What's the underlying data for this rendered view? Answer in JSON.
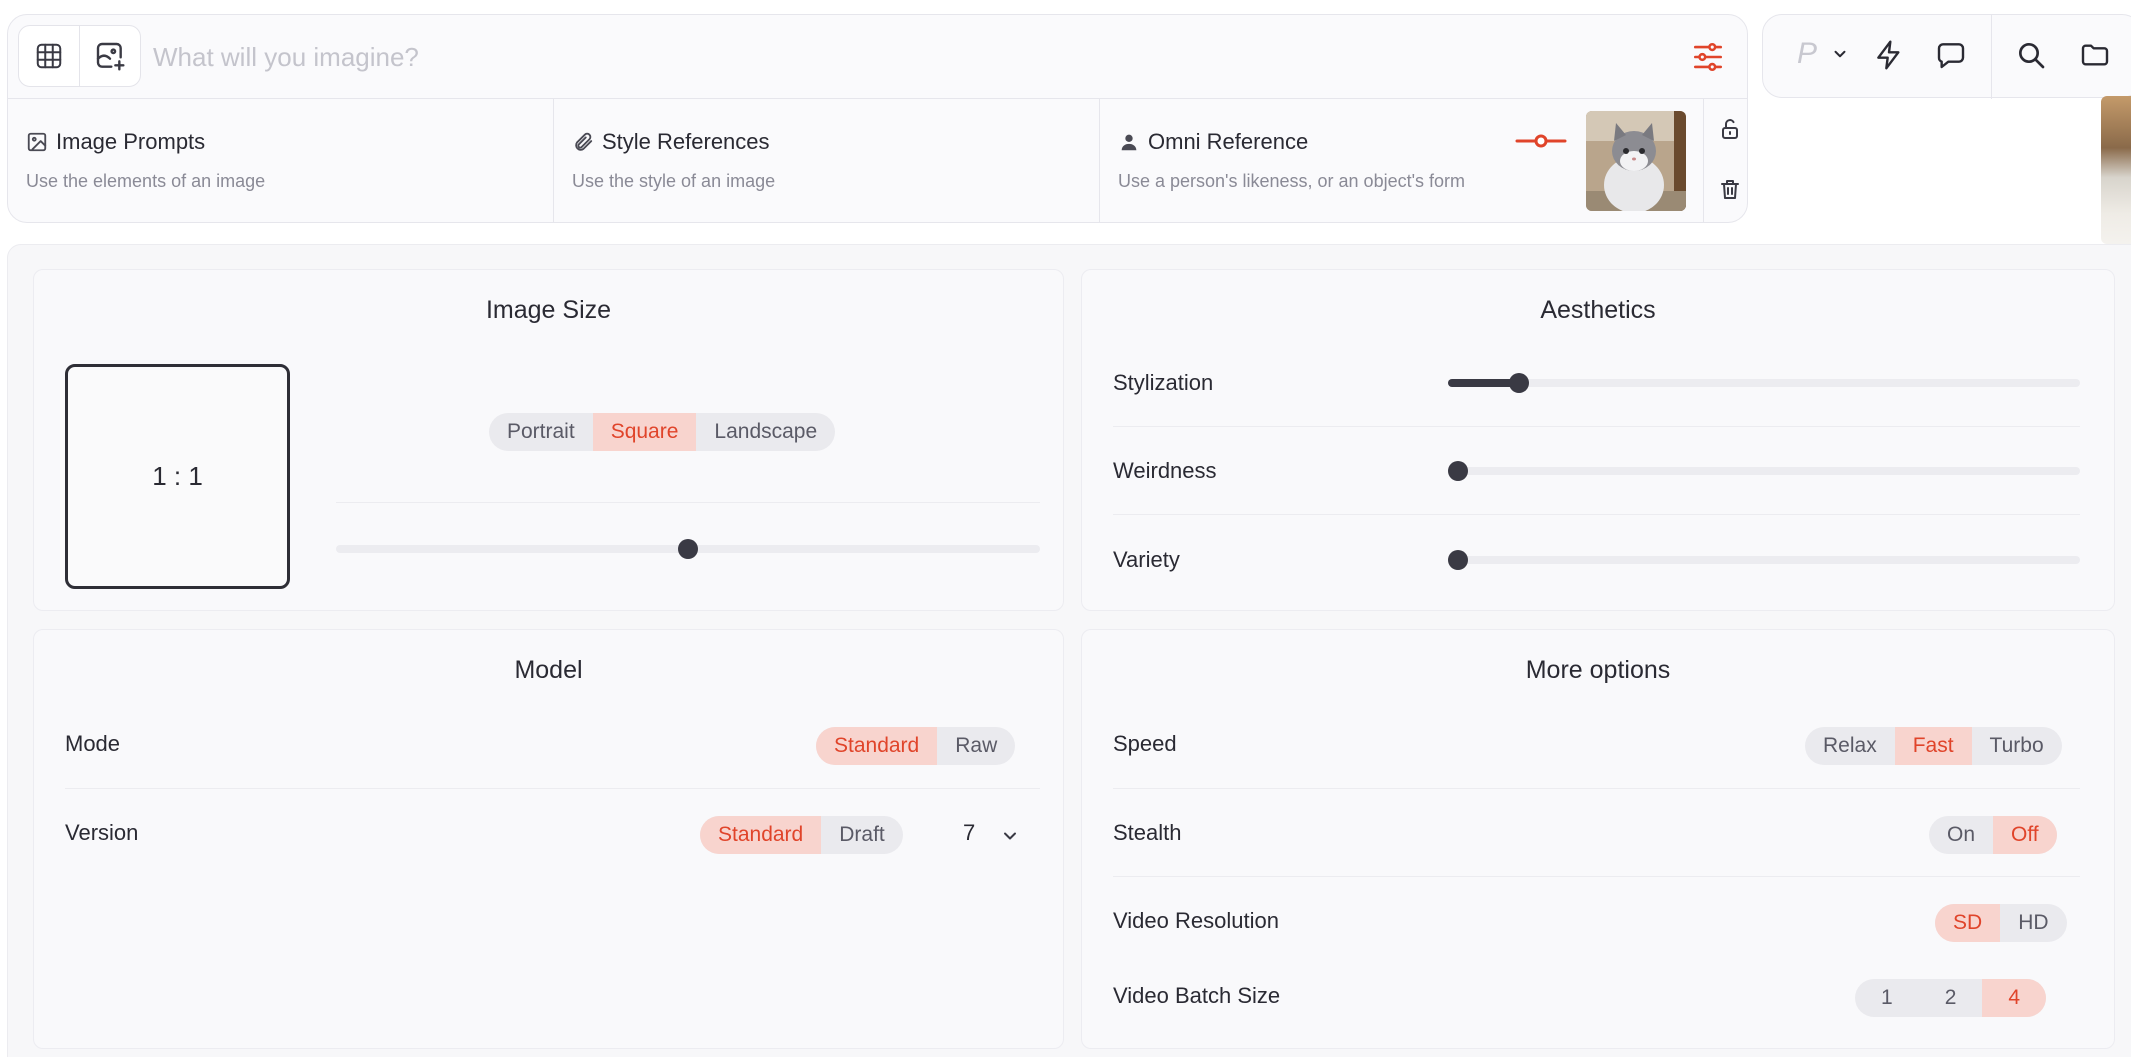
{
  "prompt": {
    "placeholder": "What will you imagine?",
    "value": ""
  },
  "references": [
    {
      "title": "Image Prompts",
      "subtitle": "Use the elements of an image"
    },
    {
      "title": "Style References",
      "subtitle": "Use the style of an image"
    },
    {
      "title": "Omni Reference",
      "subtitle": "Use a person's likeness, or an object's form"
    }
  ],
  "topbar": {
    "personalize_letter": "P"
  },
  "image_size": {
    "title": "Image Size",
    "ratio": "1 : 1",
    "options": [
      "Portrait",
      "Square",
      "Landscape"
    ],
    "selected": "Square",
    "slider_value": 0.5
  },
  "aesthetics": {
    "title": "Aesthetics",
    "sliders": [
      {
        "label": "Stylization",
        "value": 0.1
      },
      {
        "label": "Weirdness",
        "value": 0
      },
      {
        "label": "Variety",
        "value": 0
      }
    ]
  },
  "model": {
    "title": "Model",
    "mode": {
      "label": "Mode",
      "options": [
        "Standard",
        "Raw"
      ],
      "selected": "Standard"
    },
    "version": {
      "label": "Version",
      "options": [
        "Standard",
        "Draft"
      ],
      "selected": "Standard",
      "number": "7"
    }
  },
  "more_options": {
    "title": "More options",
    "speed": {
      "label": "Speed",
      "options": [
        "Relax",
        "Fast",
        "Turbo"
      ],
      "selected": "Fast"
    },
    "stealth": {
      "label": "Stealth",
      "options": [
        "On",
        "Off"
      ],
      "selected": "Off"
    },
    "video_resolution": {
      "label": "Video Resolution",
      "options": [
        "SD",
        "HD"
      ],
      "selected": "SD"
    },
    "video_batch_size": {
      "label": "Video Batch Size",
      "options": [
        "1",
        "2",
        "4"
      ],
      "selected": "4"
    }
  },
  "colors": {
    "accent": "#e0442a",
    "accent_bg": "#f8d4ce",
    "text": "#2a2a33",
    "muted": "#8a8a96"
  }
}
